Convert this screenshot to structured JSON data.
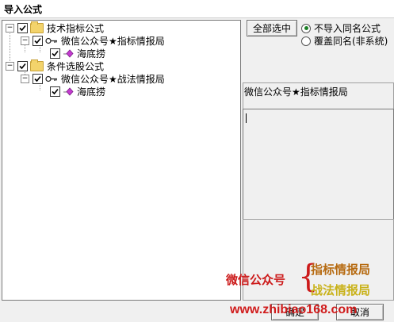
{
  "window": {
    "title": "导入公式"
  },
  "tree": {
    "groups": [
      {
        "label": "技术指标公式",
        "expander": "−",
        "checked": true,
        "children": [
          {
            "label": "微信公众号★指标情报局",
            "expander": "−",
            "checked": true,
            "children": [
              {
                "label": "海底捞",
                "checked": true
              }
            ]
          }
        ]
      },
      {
        "label": "条件选股公式",
        "expander": "−",
        "checked": true,
        "children": [
          {
            "label": "微信公众号★战法情报局",
            "expander": "−",
            "checked": true,
            "children": [
              {
                "label": "海底捞",
                "checked": true
              }
            ]
          }
        ]
      }
    ]
  },
  "options": {
    "select_all_label": "全部选中",
    "radio_skip_label": "不导入同名公式",
    "radio_overwrite_label": "覆盖同名(非系统)",
    "selected": "skip"
  },
  "detail": {
    "formula_name": "微信公众号★指标情报局",
    "description": ""
  },
  "buttons": {
    "ok_label": "确定",
    "cancel_label": "取消"
  },
  "watermark": {
    "left_text": "微信公众号",
    "brace": "{",
    "top_text": "指标情报局",
    "bottom_text": "战法情报局",
    "url": "www.zhibiao168.com"
  },
  "colors": {
    "accent_radio": "#1a7f24",
    "watermark_red": "#cc1a1a",
    "folder": "#f3d36b"
  }
}
